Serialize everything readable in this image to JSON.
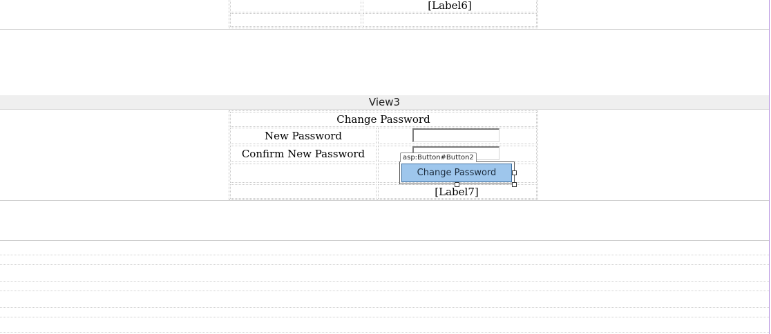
{
  "top_fragment": {
    "label": "[Label6]"
  },
  "view3": {
    "header": "View3",
    "table_title": "Change Password",
    "new_password_label": "New Password",
    "confirm_password_label": "Confirm New Password",
    "new_password_value": "",
    "confirm_password_value": "",
    "control_tag": "asp:Button#Button2",
    "button_label": "Change Password",
    "result_label": "[Label7]"
  },
  "colors": {
    "button_fill": "#9ec6ec",
    "button_border": "#3d6f9f",
    "view_header_bg": "#efefef",
    "designer_edge": "#b48fe0"
  }
}
